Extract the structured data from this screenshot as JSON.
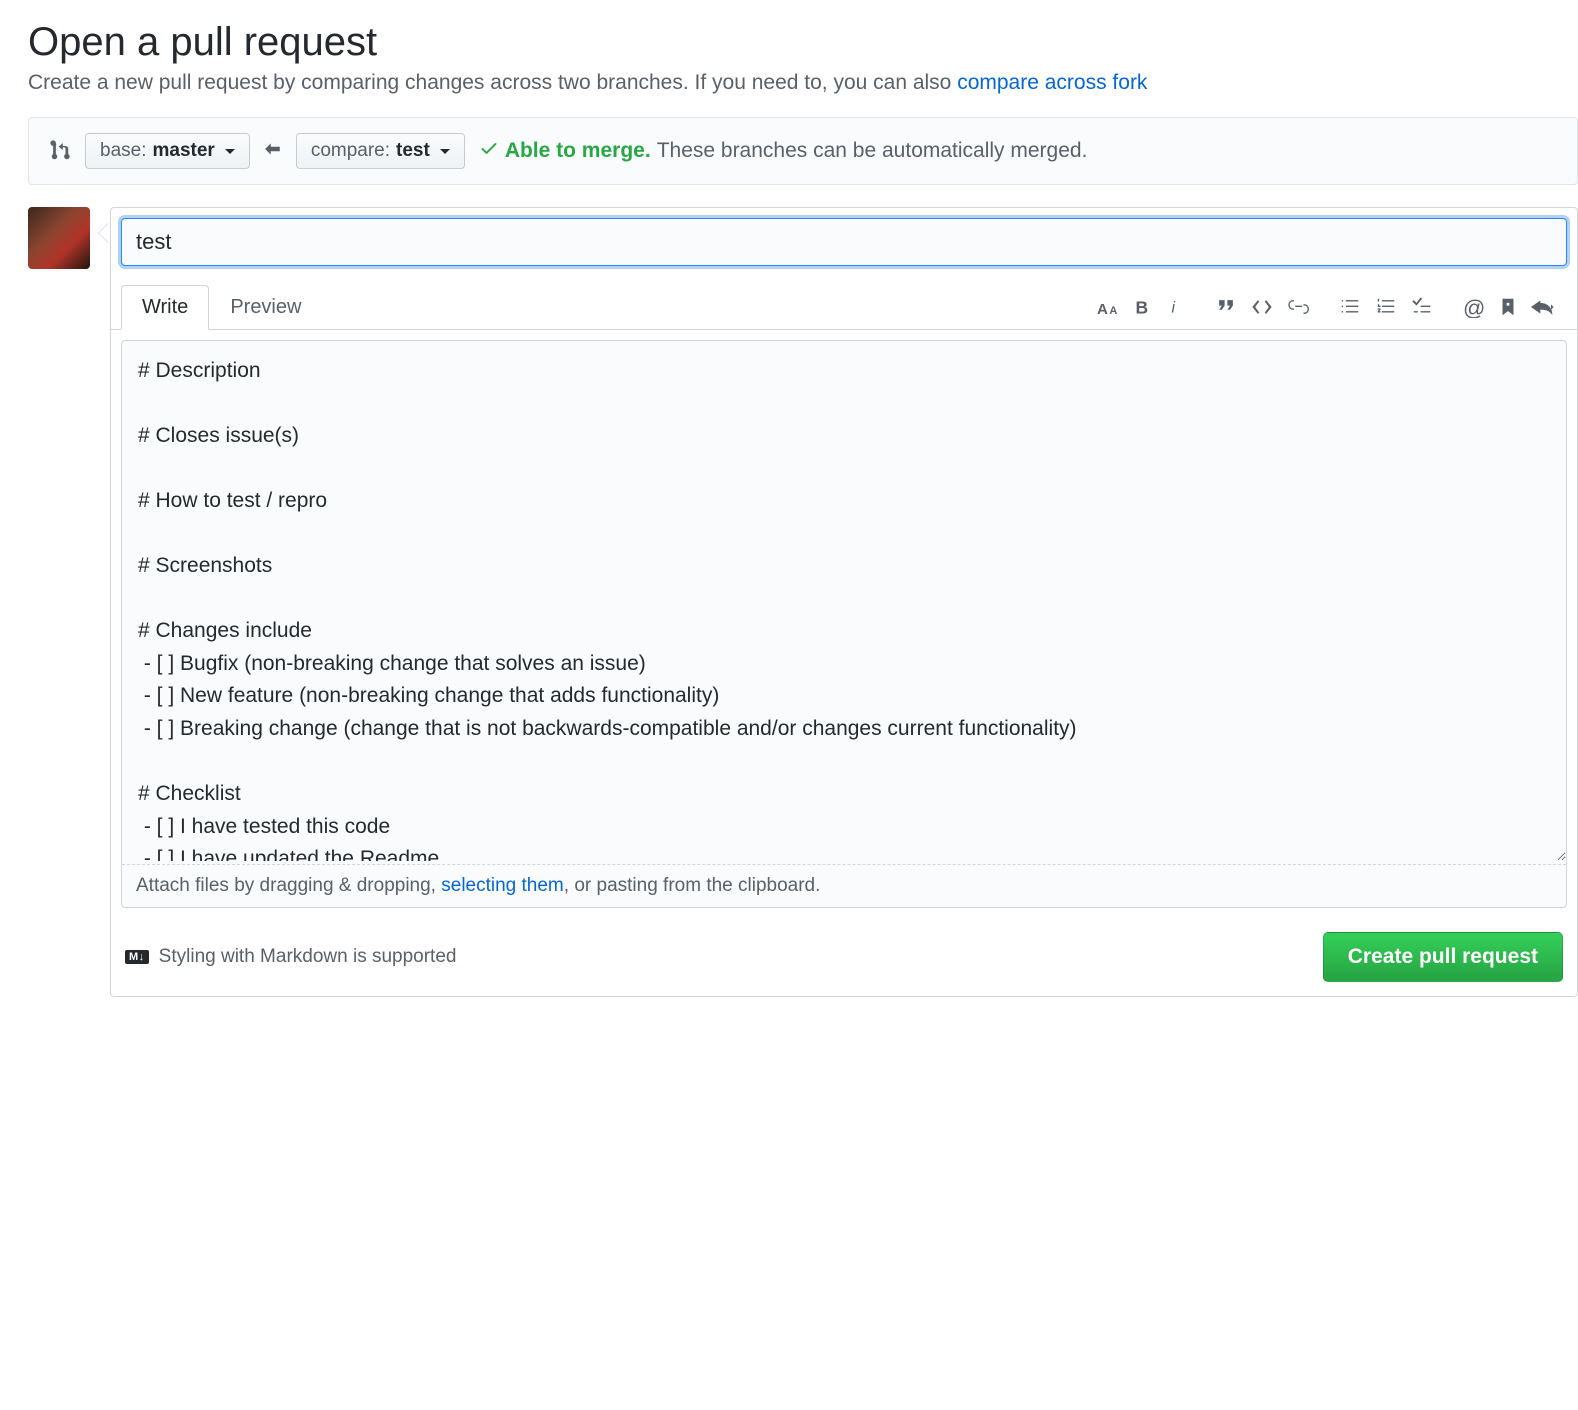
{
  "header": {
    "title": "Open a pull request",
    "subtitle_pre": "Create a new pull request by comparing changes across two branches. If you need to, you can also ",
    "subtitle_link": "compare across fork"
  },
  "compare": {
    "base_label": "base:",
    "base_value": "master",
    "compare_label": "compare:",
    "compare_value": "test",
    "merge_ok": "Able to merge.",
    "merge_detail": "These branches can be automatically merged."
  },
  "form": {
    "title_value": "test",
    "tabs": {
      "write": "Write",
      "preview": "Preview"
    },
    "body": "# Description\n\n# Closes issue(s)\n\n# How to test / repro\n\n# Screenshots\n\n# Changes include\n - [ ] Bugfix (non-breaking change that solves an issue)\n - [ ] New feature (non-breaking change that adds functionality)\n - [ ] Breaking change (change that is not backwards-compatible and/or changes current functionality)\n\n# Checklist\n - [ ] I have tested this code\n - [ ] I have updated the Readme",
    "attach_pre": "Attach files by dragging & dropping, ",
    "attach_link": "selecting them",
    "attach_post": ", or pasting from the clipboard.",
    "md_badge": "M↓",
    "md_hint": "Styling with Markdown is supported",
    "submit": "Create pull request"
  }
}
